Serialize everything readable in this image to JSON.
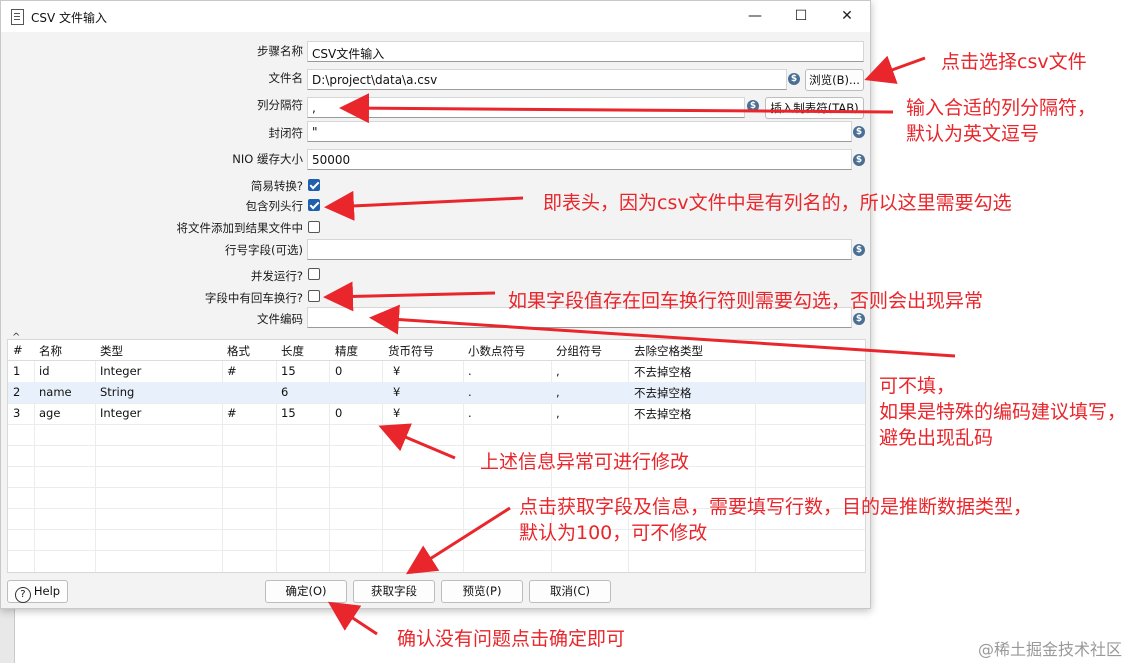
{
  "window": {
    "title": "CSV 文件输入",
    "minimize": "—",
    "maximize": "☐",
    "close": "✕"
  },
  "form": {
    "step_name_label": "步骤名称",
    "step_name_value": "CSV文件输入",
    "filename_label": "文件名",
    "filename_value": "D:\\project\\data\\a.csv",
    "browse_label": "浏览(B)...",
    "delimiter_label": "列分隔符",
    "delimiter_value": ",",
    "insert_tab_label": "插入制表符(TAB)",
    "enclosure_label": "封闭符",
    "enclosure_value": "\"",
    "nio_label": "NIO 缓存大小",
    "nio_value": "50000",
    "lazy_label": "简易转换?",
    "header_label": "包含列头行",
    "add_result_label": "将文件添加到结果文件中",
    "rownum_label": "行号字段(可选)",
    "rownum_value": "",
    "parallel_label": "并发运行?",
    "newline_label": "字段中有回车换行?",
    "encoding_label": "文件编码",
    "encoding_value": ""
  },
  "checkboxes": {
    "lazy": true,
    "header": true,
    "add_result": false,
    "parallel": false,
    "newline": false
  },
  "table": {
    "columns": [
      "#",
      "名称",
      "类型",
      "格式",
      "长度",
      "精度",
      "货币符号",
      "小数点符号",
      "分组符号",
      "去除空格类型"
    ],
    "rows": [
      [
        "1",
        "id",
        "Integer",
        "#",
        "15",
        "0",
        "¥",
        ".",
        ",",
        "不去掉空格"
      ],
      [
        "2",
        "name",
        "String",
        "",
        "6",
        "",
        "¥",
        ".",
        ",",
        "不去掉空格"
      ],
      [
        "3",
        "age",
        "Integer",
        "#",
        "15",
        "0",
        "¥",
        ".",
        ",",
        "不去掉空格"
      ]
    ]
  },
  "buttons": {
    "help": "Help",
    "ok": "确定(O)",
    "get_fields": "获取字段",
    "preview": "预览(P)",
    "cancel": "取消(C)"
  },
  "annotations": {
    "a1": "点击选择csv文件",
    "a2": "输入合适的列分隔符，\n默认为英文逗号",
    "a3": "即表头，因为csv文件中是有列名的，所以这里需要勾选",
    "a4": "如果字段值存在回车换行符则需要勾选，否则会出现异常",
    "a5": "可不填，\n如果是特殊的编码建议填写，\n避免出现乱码",
    "a6": "上述信息异常可进行修改",
    "a7": "点击获取字段及信息，需要填写行数，目的是推断数据类型，\n默认为100，可不修改",
    "a8": "确认没有问题点击确定即可"
  },
  "watermark": "@稀土掘金技术社区",
  "colors": {
    "annotation_red": "#e8262b",
    "checkbox_blue": "#1f5fad",
    "variable_icon": "#4a6f95",
    "selected_row": "#e8f1fb"
  }
}
